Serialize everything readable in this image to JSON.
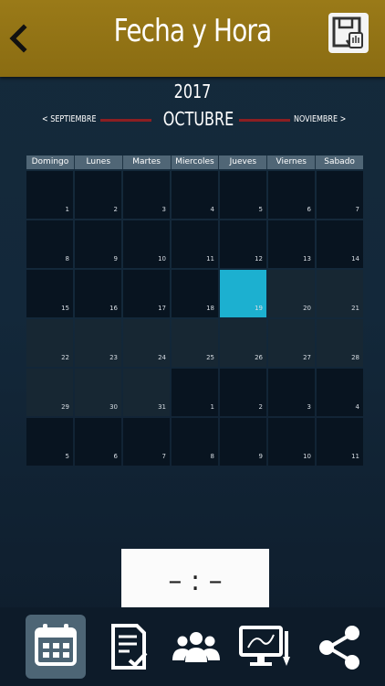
{
  "header": {
    "title": "Fecha y Hora"
  },
  "calendar": {
    "year": "2017",
    "prev_month": "< SEPTIEMBRE",
    "current_month": "OCTUBRE",
    "next_month": "NOVIEMBRE >",
    "weekdays": [
      "Domingo",
      "Lunes",
      "Martes",
      "Miercoles",
      "Jueves",
      "Viernes",
      "Sabado"
    ],
    "days": [
      {
        "label": "1",
        "shade": "dark",
        "selected": false
      },
      {
        "label": "2",
        "shade": "dark",
        "selected": false
      },
      {
        "label": "3",
        "shade": "dark",
        "selected": false
      },
      {
        "label": "4",
        "shade": "dark",
        "selected": false
      },
      {
        "label": "5",
        "shade": "dark",
        "selected": false
      },
      {
        "label": "6",
        "shade": "dark",
        "selected": false
      },
      {
        "label": "7",
        "shade": "dark",
        "selected": false
      },
      {
        "label": "8",
        "shade": "dark",
        "selected": false
      },
      {
        "label": "9",
        "shade": "dark",
        "selected": false
      },
      {
        "label": "10",
        "shade": "dark",
        "selected": false
      },
      {
        "label": "11",
        "shade": "dark",
        "selected": false
      },
      {
        "label": "12",
        "shade": "dark",
        "selected": false
      },
      {
        "label": "13",
        "shade": "dark",
        "selected": false
      },
      {
        "label": "14",
        "shade": "dark",
        "selected": false
      },
      {
        "label": "15",
        "shade": "dark",
        "selected": false
      },
      {
        "label": "16",
        "shade": "dark",
        "selected": false
      },
      {
        "label": "17",
        "shade": "dark",
        "selected": false
      },
      {
        "label": "18",
        "shade": "dark",
        "selected": false
      },
      {
        "label": "19",
        "shade": "dark",
        "selected": true
      },
      {
        "label": "20",
        "shade": "light",
        "selected": false
      },
      {
        "label": "21",
        "shade": "light",
        "selected": false
      },
      {
        "label": "22",
        "shade": "light",
        "selected": false
      },
      {
        "label": "23",
        "shade": "light",
        "selected": false
      },
      {
        "label": "24",
        "shade": "light",
        "selected": false
      },
      {
        "label": "25",
        "shade": "light",
        "selected": false
      },
      {
        "label": "26",
        "shade": "light",
        "selected": false
      },
      {
        "label": "27",
        "shade": "light",
        "selected": false
      },
      {
        "label": "28",
        "shade": "light",
        "selected": false
      },
      {
        "label": "29",
        "shade": "light",
        "selected": false
      },
      {
        "label": "30",
        "shade": "light",
        "selected": false
      },
      {
        "label": "31",
        "shade": "light",
        "selected": false
      },
      {
        "label": "1",
        "shade": "dark",
        "selected": false
      },
      {
        "label": "2",
        "shade": "dark",
        "selected": false
      },
      {
        "label": "3",
        "shade": "dark",
        "selected": false
      },
      {
        "label": "4",
        "shade": "dark",
        "selected": false
      },
      {
        "label": "5",
        "shade": "dark",
        "selected": false
      },
      {
        "label": "6",
        "shade": "dark",
        "selected": false
      },
      {
        "label": "7",
        "shade": "dark",
        "selected": false
      },
      {
        "label": "8",
        "shade": "dark",
        "selected": false
      },
      {
        "label": "9",
        "shade": "dark",
        "selected": false
      },
      {
        "label": "10",
        "shade": "dark",
        "selected": false
      },
      {
        "label": "11",
        "shade": "dark",
        "selected": false
      }
    ]
  },
  "time": {
    "value": "– : –"
  },
  "bottom_nav": {
    "items": [
      {
        "icon": "calendar-icon",
        "active": true
      },
      {
        "icon": "checklist-icon",
        "active": false
      },
      {
        "icon": "group-icon",
        "active": false
      },
      {
        "icon": "monitor-icon",
        "active": false
      },
      {
        "icon": "share-icon",
        "active": false
      }
    ]
  },
  "colors": {
    "header": "#8f7014",
    "selected_day": "#1cb0d0",
    "month_line": "#8c1e22",
    "weekday_bar": "#506676",
    "nav_active": "#4d6575"
  }
}
